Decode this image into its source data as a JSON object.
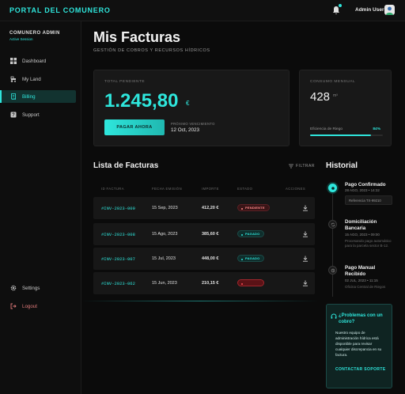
{
  "header": {
    "brand": "PORTAL DEL COMUNERO",
    "user_name": "Admin User"
  },
  "sidebar": {
    "profile_name": "COMUNERO ADMIN",
    "profile_status": "Active Session",
    "items": [
      {
        "label": "Dashboard",
        "icon": "grid-icon"
      },
      {
        "label": "My Land",
        "icon": "tractor-icon"
      },
      {
        "label": "Billing",
        "icon": "receipt-icon",
        "active": true
      },
      {
        "label": "Support",
        "icon": "help-icon"
      }
    ],
    "bottom_items": [
      {
        "label": "Settings",
        "icon": "gear-icon"
      },
      {
        "label": "Logout",
        "icon": "logout-icon"
      }
    ]
  },
  "page": {
    "title": "Mis Facturas",
    "subtitle": "GESTIÓN DE COBROS Y RECURSOS HÍDRICOS"
  },
  "pending": {
    "label": "TOTAL PENDIENTE",
    "amount": "1.245,80",
    "currency": "€",
    "pay_button": "PAGAR AHORA",
    "due_label": "PRÓXIMO VENCIMIENTO",
    "due_date": "12 Oct, 2023"
  },
  "water": {
    "label": "CONSUMO MENSUAL",
    "value": "428",
    "unit": "m³",
    "efficiency_label": "Eficiencia de Riego",
    "efficiency_value": "84%",
    "efficiency_fraction": 0.84
  },
  "invoices": {
    "title": "Lista de Facturas",
    "filter_label": "FILTRAR",
    "columns": [
      "ID FACTURA",
      "FECHA EMISIÓN",
      "IMPORTE",
      "ESTADO",
      "ACCIONES"
    ],
    "rows": [
      {
        "id": "#INV-2023-009",
        "date": "15 Sep, 2023",
        "amount": "412,20 €",
        "status": "PENDIENTE",
        "status_kind": "pending"
      },
      {
        "id": "#INV-2023-008",
        "date": "15 Ago, 2023",
        "amount": "385,60 €",
        "status": "PAGADO",
        "status_kind": "paid"
      },
      {
        "id": "#INV-2023-007",
        "date": "15 Jul, 2023",
        "amount": "448,00 €",
        "status": "PAGADO",
        "status_kind": "paid"
      },
      {
        "id": "#INV-2023-062",
        "date": "15 Jun, 2023",
        "amount": "210,15 €",
        "status": "",
        "status_kind": "overdue"
      }
    ]
  },
  "history": {
    "title": "Historial",
    "events": [
      {
        "title": "Pago Confirmado",
        "date": "28 AGO, 2023 • 14:32",
        "ref": "Referencia TX-99210"
      },
      {
        "title": "Domiciliación Bancaria",
        "date": "15 AGO, 2023 • 09:00",
        "desc": "Procesando pago automático para la parcela sector B-12."
      },
      {
        "title": "Pago Manual Recibido",
        "date": "02 JUL, 2023 • 11:15",
        "desc": "Oficina Central de Riegos"
      }
    ]
  },
  "support": {
    "title": "¿Problemas con un cobro?",
    "text": "Nuestro equipo de administración hídrica está disponible para revisar cualquier discrepancia en su factura.",
    "link": "CONTACTAR SOPORTE"
  },
  "colors": {
    "accent": "#2ee6dc",
    "danger": "#ff4d55",
    "background": "#0b0b0b"
  }
}
